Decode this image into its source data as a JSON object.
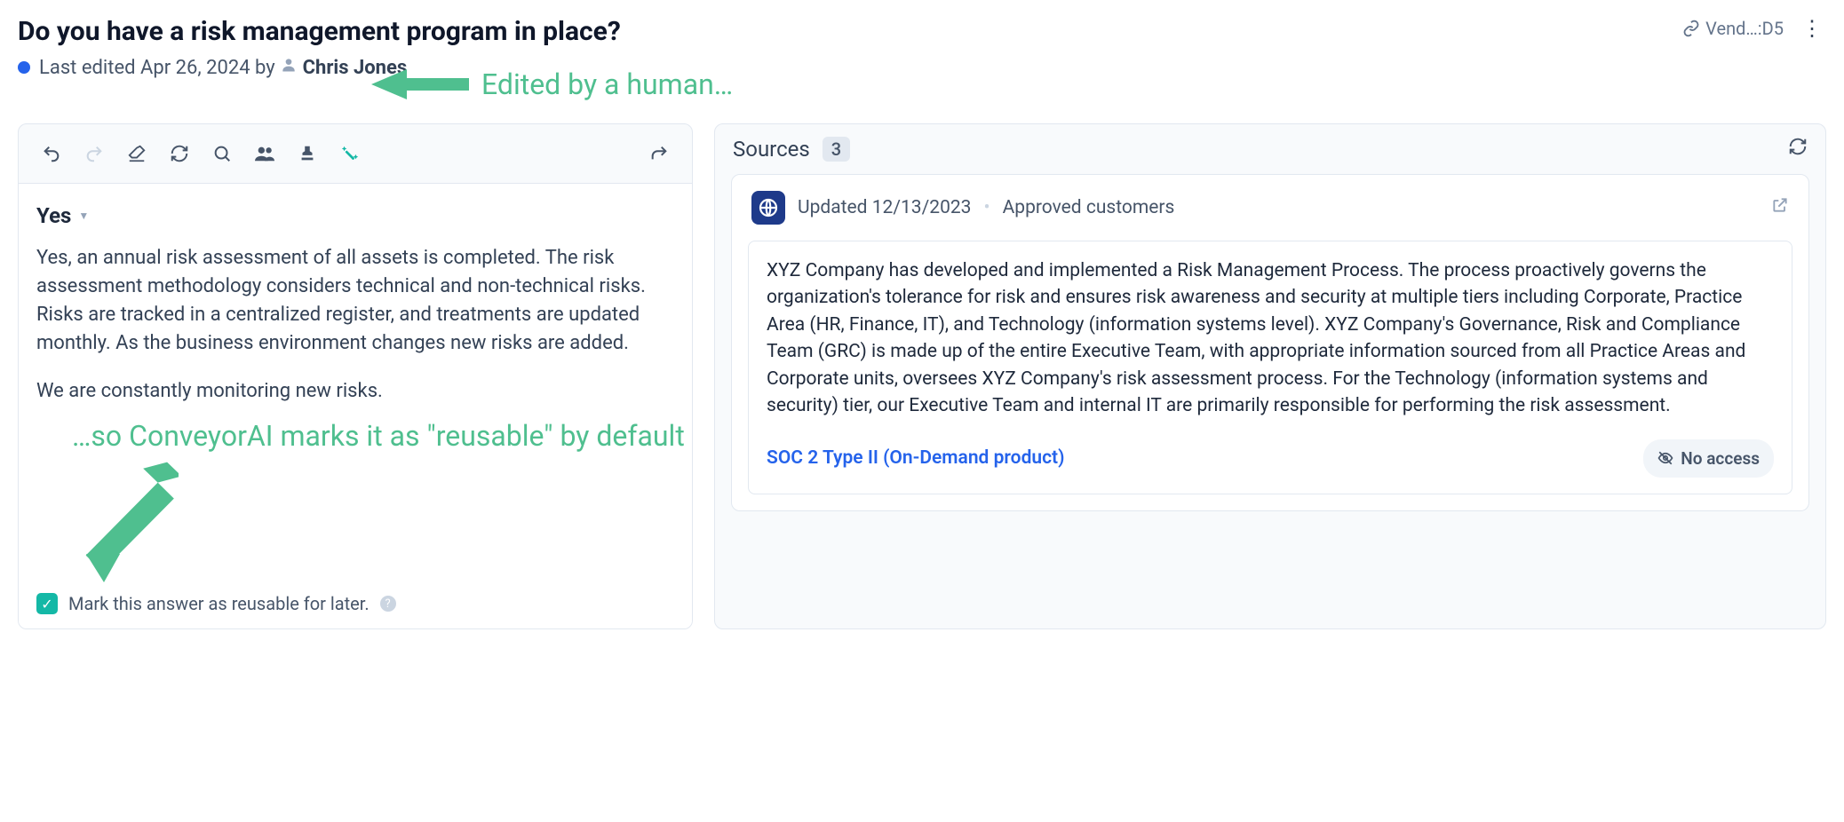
{
  "header": {
    "title": "Do you have a risk management program in place?",
    "last_edited_prefix": "Last edited ",
    "last_edited_date": "Apr 26, 2024",
    "by": " by ",
    "editor": "Chris Jones",
    "breadcrumb": "Vend…:D5"
  },
  "annotations": {
    "top": "Edited by a human…",
    "mid": "…so ConveyorAI marks it as \"reusable\" by default"
  },
  "editor": {
    "answer_label": "Yes",
    "paragraph1": "Yes, an annual risk assessment of all assets is completed. The risk assessment methodology considers technical and non-technical risks. Risks are tracked in a centralized register, and treatments are updated monthly. As the business environment changes new risks are added.",
    "paragraph2": "We are constantly monitoring new risks.",
    "reusable_label": "Mark this answer as reusable for later."
  },
  "sources": {
    "heading": "Sources",
    "count": "3",
    "card": {
      "updated_label": "Updated 12/13/2023",
      "audience": "Approved customers",
      "body": "XYZ Company has developed and implemented a Risk Management Process. The process proactively governs the organization's tolerance for risk and ensures risk awareness and security at multiple tiers including Corporate, Practice Area (HR, Finance, IT), and Technology (information systems level). XYZ Company's Governance, Risk and Compliance Team (GRC) is made up of the entire Executive Team, with appropriate information sourced from all Practice Areas and Corporate units, oversees XYZ Company's risk assessment process. For the Technology (information systems and security) tier, our Executive Team and internal IT are primarily responsible for performing the risk assessment.",
      "link": "SOC 2 Type II (On-Demand product)",
      "no_access": "No access"
    }
  }
}
